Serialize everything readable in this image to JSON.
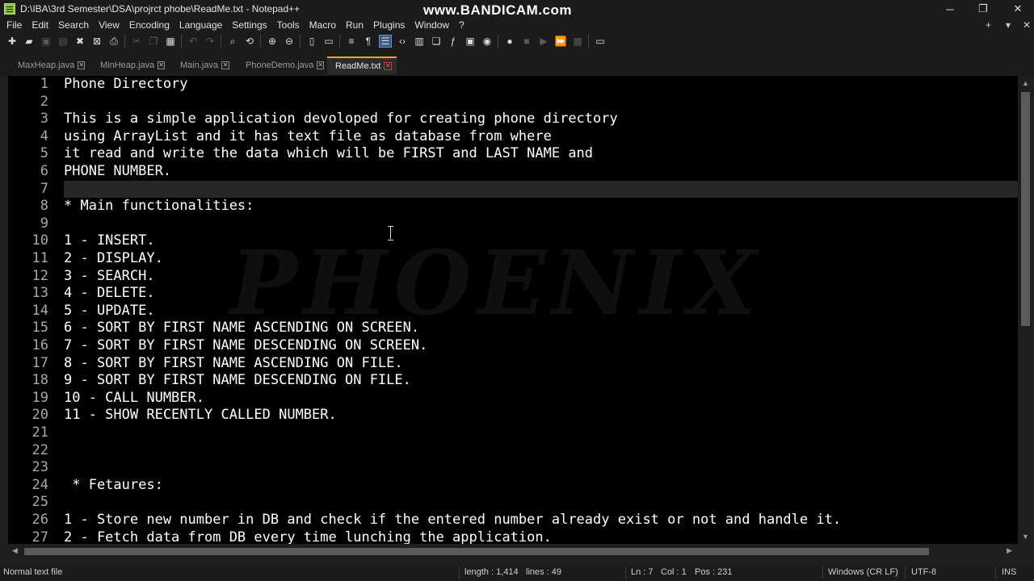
{
  "window": {
    "title": "D:\\IBA\\3rd Semester\\DSA\\projrct phobe\\ReadMe.txt - Notepad++",
    "watermark": "www.BANDICAM.com",
    "minimize": "─",
    "restore": "❐",
    "close": "✕"
  },
  "menu": {
    "items": [
      "File",
      "Edit",
      "Search",
      "View",
      "Encoding",
      "Language",
      "Settings",
      "Tools",
      "Macro",
      "Run",
      "Plugins",
      "Window",
      "?"
    ],
    "add_tab": "+",
    "list_tabs": "▾",
    "close_doc": "✕"
  },
  "tabs": [
    {
      "label": "MaxHeap.java",
      "active": false
    },
    {
      "label": "MinHeap.java",
      "active": false
    },
    {
      "label": "Main.java",
      "active": false
    },
    {
      "label": "PhoneDemo.java",
      "active": false
    },
    {
      "label": "ReadMe.txt",
      "active": true
    }
  ],
  "editor": {
    "current_line": 7,
    "background_watermark": "PHOENIX",
    "lines": [
      {
        "n": "1",
        "text": "Phone Directory"
      },
      {
        "n": "2",
        "text": ""
      },
      {
        "n": "3",
        "text": "This is a simple application devoloped for creating phone directory"
      },
      {
        "n": "4",
        "text": "using ArrayList and it has text file as database from where"
      },
      {
        "n": "5",
        "text": "it read and write the data which will be FIRST and LAST NAME and"
      },
      {
        "n": "6",
        "text": "PHONE NUMBER."
      },
      {
        "n": "7",
        "text": ""
      },
      {
        "n": "8",
        "text": "* Main functionalities:"
      },
      {
        "n": "9",
        "text": ""
      },
      {
        "n": "10",
        "text": "1 - INSERT."
      },
      {
        "n": "11",
        "text": "2 - DISPLAY."
      },
      {
        "n": "12",
        "text": "3 - SEARCH."
      },
      {
        "n": "13",
        "text": "4 - DELETE."
      },
      {
        "n": "14",
        "text": "5 - UPDATE."
      },
      {
        "n": "15",
        "text": "6 - SORT BY FIRST NAME ASCENDING ON SCREEN."
      },
      {
        "n": "16",
        "text": "7 - SORT BY FIRST NAME DESCENDING ON SCREEN."
      },
      {
        "n": "17",
        "text": "8 - SORT BY FIRST NAME ASCENDING ON FILE."
      },
      {
        "n": "18",
        "text": "9 - SORT BY FIRST NAME DESCENDING ON FILE."
      },
      {
        "n": "19",
        "text": "10 - CALL NUMBER."
      },
      {
        "n": "20",
        "text": "11 - SHOW RECENTLY CALLED NUMBER."
      },
      {
        "n": "21",
        "text": ""
      },
      {
        "n": "22",
        "text": ""
      },
      {
        "n": "23",
        "text": ""
      },
      {
        "n": "24",
        "text": " * Fetaures:"
      },
      {
        "n": "25",
        "text": ""
      },
      {
        "n": "26",
        "text": "1 - Store new number in DB and check if the entered number already exist or not and handle it."
      },
      {
        "n": "27",
        "text": "2 - Fetch data from DB every time lunching the application."
      }
    ]
  },
  "status": {
    "file_type": "Normal text file",
    "length": "length : 1,414",
    "lines": "lines : 49",
    "ln": "Ln : 7",
    "col": "Col : 1",
    "pos": "Pos : 231",
    "eol": "Windows (CR LF)",
    "encoding": "UTF-8",
    "mode": "INS"
  }
}
